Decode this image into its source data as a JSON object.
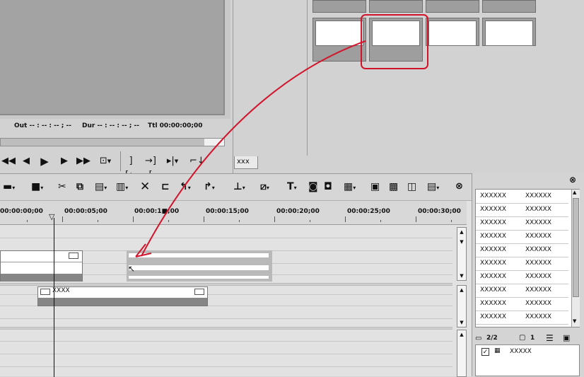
{
  "player": {
    "out_label": "Out -- : -- : -- ; --",
    "dur_label": "Dur -- : -- : -- ; --",
    "ttl_label": "Ttl 00:00:00;00",
    "scrub_progress": 0.91,
    "transport": {
      "rewind": "◀◀",
      "step_back": "◀",
      "play": "▶",
      "step_forward": "▶",
      "fast_forward": "▶▶"
    }
  },
  "bin": {
    "tab_label": "xxx"
  },
  "timeline": {
    "ruler": [
      "00:00:00;00",
      "00:00:05;00",
      "00:00:1■;00",
      "00:00:15;00",
      "00:00:20;00",
      "00:00:25;00",
      "00:00:30;00"
    ],
    "clip_label": "XXXX"
  },
  "list": {
    "rows": [
      [
        "XXXXXX",
        "XXXXXX"
      ],
      [
        "XXXXXX",
        "XXXXXX"
      ],
      [
        "XXXXXX",
        "XXXXXX"
      ],
      [
        "XXXXXX",
        "XXXXXX"
      ],
      [
        "XXXXXX",
        "XXXXXX"
      ],
      [
        "XXXXXX",
        "XXXXXX"
      ],
      [
        "XXXXXX",
        "XXXXXX"
      ],
      [
        "XXXXXX",
        "XXXXXX"
      ],
      [
        "XXXXXX",
        "XXXXXX"
      ],
      [
        "XXXXXX",
        "XXXXXX"
      ]
    ],
    "page_count": "2/2",
    "layer_count": "1",
    "layer_name": "XXXXX"
  },
  "colors": {
    "highlight": "#d2142b",
    "panel": "#d2d2d2",
    "preview": "#a3a3a3"
  }
}
